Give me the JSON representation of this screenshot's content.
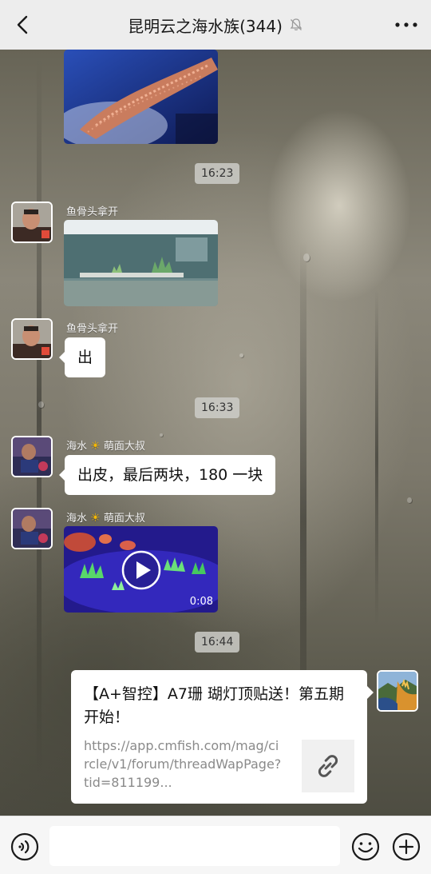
{
  "header": {
    "title": "昆明云之海水族(344)"
  },
  "messages": {
    "time_1": "16:23",
    "time_2": "16:33",
    "time_3": "16:44",
    "sender_1": "鱼骨头拿开",
    "sender_2": "鱼骨头拿开",
    "sender_3_prefix": "海水",
    "sender_3_suffix": "萌面大叔",
    "sender_4_prefix": "海水",
    "sender_4_suffix": "萌面大叔",
    "text_chu": "出",
    "text_price": "出皮，最后两块，180 一块",
    "video_duration": "0:08"
  },
  "link_card": {
    "title": "【A+智控】A7珊 瑚灯顶贴送！第五期开始！",
    "url": "https://app.cmfish.com/mag/circle/v1/forum/threadWapPage?tid=811199..."
  },
  "input": {
    "placeholder": ""
  },
  "colors": {
    "topbar_bg": "#ededed",
    "bubble_bg": "#ffffff",
    "input_bar_bg": "#f6f6f6"
  }
}
